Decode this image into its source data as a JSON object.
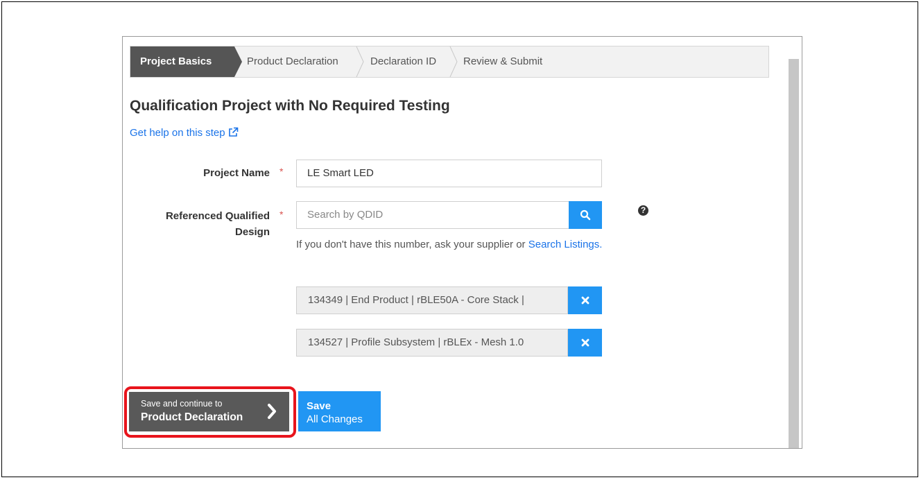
{
  "wizard": {
    "steps": [
      {
        "label": "Project Basics",
        "active": true
      },
      {
        "label": "Product Declaration",
        "active": false
      },
      {
        "label": "Declaration ID",
        "active": false
      },
      {
        "label": "Review & Submit",
        "active": false
      }
    ]
  },
  "page": {
    "heading": "Qualification Project with No Required Testing",
    "help_link": "Get help on this step"
  },
  "form": {
    "project_name": {
      "label": "Project Name",
      "required_mark": "*",
      "value": "LE Smart LED"
    },
    "referenced_design": {
      "label_line1": "Referenced Qualified",
      "label_line2": "Design",
      "required_mark": "*",
      "placeholder": "Search by QDID",
      "hint_text": "If you don't have this number, ask your supplier or ",
      "hint_link": "Search Listings",
      "hint_end": ".",
      "selected": [
        "134349 | End Product | rBLE50A - Core Stack |",
        "134527 | Profile Subsystem | rBLEx - Mesh 1.0"
      ]
    }
  },
  "actions": {
    "continue_line1": "Save and continue to",
    "continue_line2": "Product Declaration",
    "save_line1": "Save",
    "save_line2": "All Changes"
  },
  "colors": {
    "accent": "#2196f3",
    "active_step": "#555555",
    "highlight": "#e8141c",
    "required": "#d9534f"
  },
  "icons": {
    "search": "search-icon",
    "remove": "close-icon",
    "help": "question-circle-icon",
    "external": "external-link-icon",
    "continue": "chevron-right-icon"
  }
}
